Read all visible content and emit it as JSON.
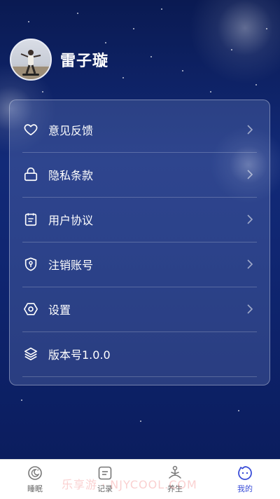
{
  "profile": {
    "username": "雷子璇"
  },
  "menu": [
    {
      "label": "意见反馈",
      "icon": "heart-icon",
      "has_arrow": true
    },
    {
      "label": "隐私条款",
      "icon": "lock-icon",
      "has_arrow": true
    },
    {
      "label": "用户协议",
      "icon": "clipboard-icon",
      "has_arrow": true
    },
    {
      "label": "注销账号",
      "icon": "shield-key-icon",
      "has_arrow": true
    },
    {
      "label": "设置",
      "icon": "hexagon-settings-icon",
      "has_arrow": true
    },
    {
      "label": "版本号1.0.0",
      "icon": "layers-icon",
      "has_arrow": false
    }
  ],
  "tabbar": {
    "tabs": [
      {
        "label": "睡眠",
        "icon": "moon-icon"
      },
      {
        "label": "记录",
        "icon": "record-icon"
      },
      {
        "label": "养生",
        "icon": "meditation-icon"
      },
      {
        "label": "我的",
        "icon": "smile-face-icon",
        "active": true
      }
    ]
  },
  "watermark": "乐享游 · NJYCOOL.COM",
  "colors": {
    "accent": "#3b4ed8",
    "background_top": "#0a1a52",
    "background_bottom": "#0b1d5e"
  }
}
